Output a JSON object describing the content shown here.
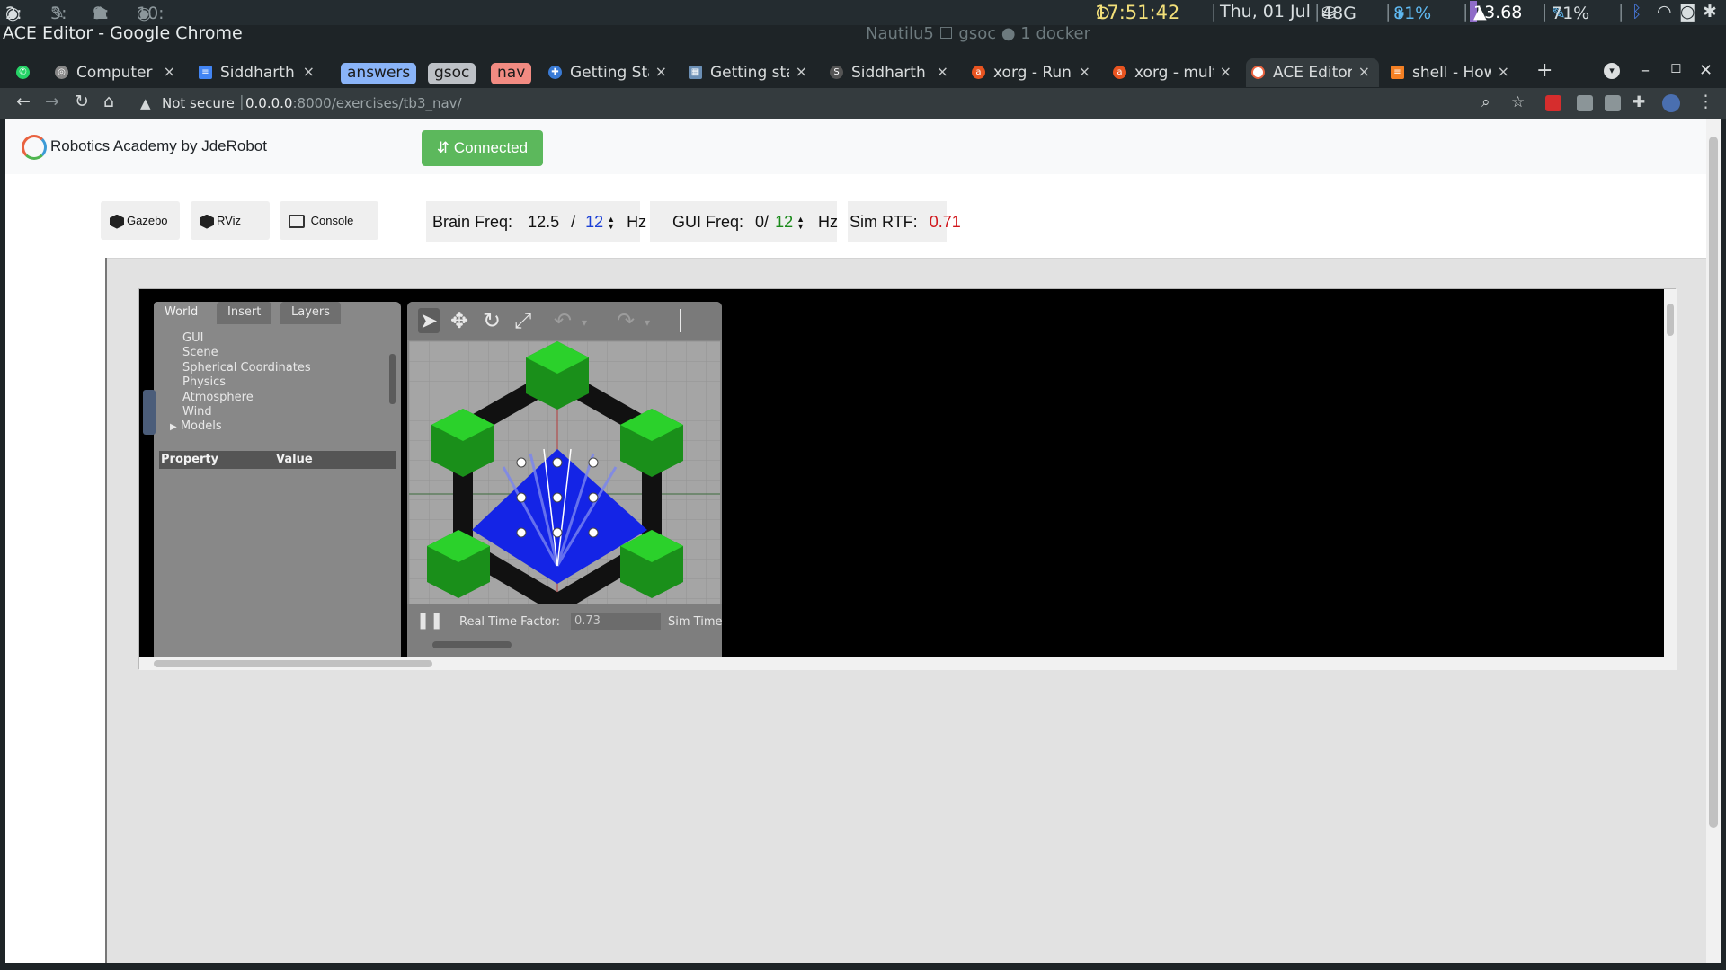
{
  "system_bar": {
    "workspaces": [
      {
        "label": "2:",
        "active": true
      },
      {
        "label": "3:",
        "active": false
      },
      {
        "label": "9:",
        "active": false
      },
      {
        "label": "10:",
        "active": false
      }
    ],
    "time": "17:51:42",
    "date": "Thu, 01 Jul",
    "disk": "48G",
    "volume": "81%",
    "load": "13.68",
    "brightness": "71%",
    "status_center": "Nautilu5 ☐ gsoc ● 1 docker"
  },
  "window": {
    "title": "ACE Editor - Google Chrome"
  },
  "tabs": [
    {
      "label": "Computer C",
      "icon": "chrome-icon"
    },
    {
      "label": "Siddharth |",
      "icon": "docs-icon"
    },
    {
      "label": "Getting Star",
      "icon": "puzzle-icon"
    },
    {
      "label": "Getting star",
      "icon": "sheet-icon"
    },
    {
      "label": "Siddharth S",
      "icon": "s-icon"
    },
    {
      "label": "xorg - Run a",
      "icon": "askubuntu-icon"
    },
    {
      "label": "xorg - multi",
      "icon": "askubuntu-icon"
    },
    {
      "label": "ACE Editor",
      "icon": "jderobot-icon",
      "active": true
    },
    {
      "label": "shell - How",
      "icon": "stackoverflow-icon"
    }
  ],
  "tab_groups": [
    {
      "label": "answers",
      "color": "#8ab4f8"
    },
    {
      "label": "gsoc",
      "color": "#bdc1c6"
    },
    {
      "label": "nav",
      "color": "#f28b82"
    }
  ],
  "address": {
    "security": "Not secure",
    "host": "0.0.0.0",
    "path": ":8000/exercises/tb3_nav/"
  },
  "page": {
    "brand": "Robotics Academy by JdeRobot",
    "connect_button": "⇵ Connected",
    "tools": [
      {
        "label": "Gazebo",
        "icon": "gazebo-icon"
      },
      {
        "label": "RViz",
        "icon": "rviz-icon"
      },
      {
        "label": "Console",
        "icon": "console-icon"
      }
    ],
    "brain_freq": {
      "label": "Brain Freq:",
      "measured": "12.5",
      "sep": "/",
      "target": "12",
      "unit": "Hz"
    },
    "gui_freq": {
      "label": "GUI Freq:",
      "measured": "0/",
      "target": "12",
      "unit": "Hz"
    },
    "sim_rtf": {
      "label": "Sim RTF:",
      "value": "0.71"
    }
  },
  "gazebo": {
    "tabs": [
      "World",
      "Insert",
      "Layers"
    ],
    "tree": [
      "GUI",
      "Scene",
      "Spherical Coordinates",
      "Physics",
      "Atmosphere",
      "Wind",
      "Models"
    ],
    "property_header": {
      "property": "Property",
      "value": "Value"
    },
    "real_time_factor_label": "Real Time Factor:",
    "real_time_factor_value": "0.73",
    "sim_time_label": "Sim Time"
  },
  "colors": {
    "connected": "#5cb85c",
    "target_brain": "#1a3fd6",
    "target_gui": "#1a8a1a",
    "rtf": "#d0161b"
  }
}
